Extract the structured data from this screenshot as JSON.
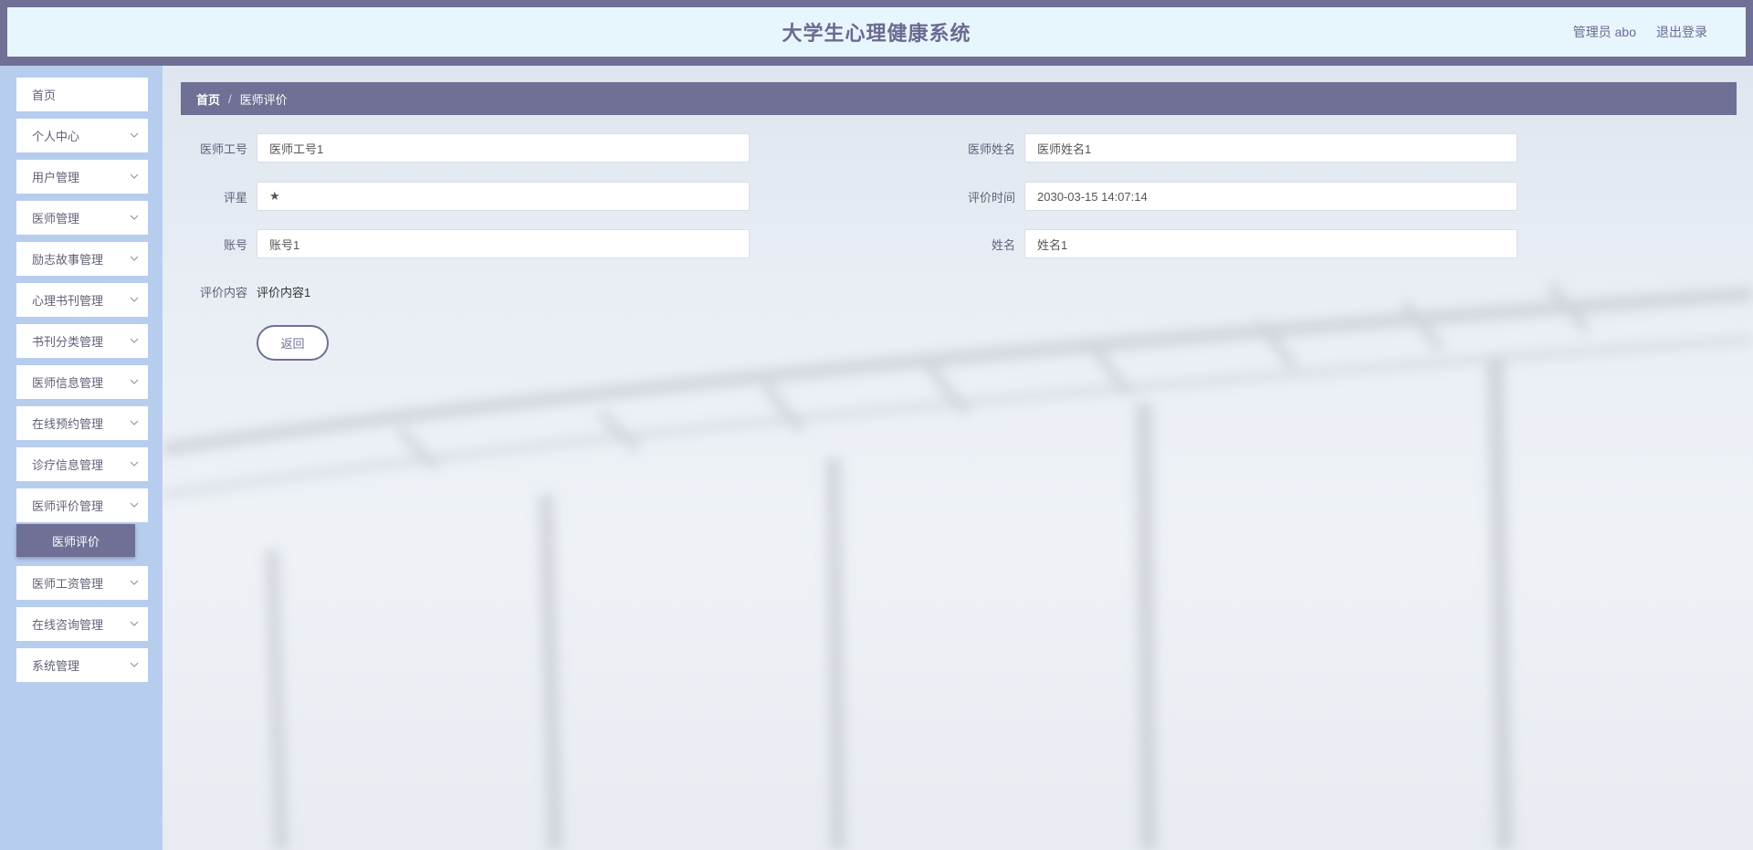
{
  "header": {
    "title": "大学生心理健康系统",
    "user_label": "管理员 abo",
    "logout_label": "退出登录"
  },
  "sidebar": {
    "items": [
      {
        "label": "首页",
        "has_chevron": false
      },
      {
        "label": "个人中心",
        "has_chevron": true
      },
      {
        "label": "用户管理",
        "has_chevron": true
      },
      {
        "label": "医师管理",
        "has_chevron": true
      },
      {
        "label": "励志故事管理",
        "has_chevron": true
      },
      {
        "label": "心理书刊管理",
        "has_chevron": true
      },
      {
        "label": "书刊分类管理",
        "has_chevron": true
      },
      {
        "label": "医师信息管理",
        "has_chevron": true
      },
      {
        "label": "在线预约管理",
        "has_chevron": true
      },
      {
        "label": "诊疗信息管理",
        "has_chevron": true
      },
      {
        "label": "医师评价管理",
        "has_chevron": true,
        "expanded": true
      },
      {
        "label": "医师工资管理",
        "has_chevron": true
      },
      {
        "label": "在线咨询管理",
        "has_chevron": true
      },
      {
        "label": "系统管理",
        "has_chevron": true
      }
    ],
    "active_sub_item": "医师评价"
  },
  "breadcrumb": {
    "home": "首页",
    "separator": "/",
    "current": "医师评价"
  },
  "form": {
    "doctor_id_label": "医师工号",
    "doctor_id_value": "医师工号1",
    "doctor_name_label": "医师姓名",
    "doctor_name_value": "医师姓名1",
    "rating_label": "评星",
    "rating_value": "★",
    "review_time_label": "评价时间",
    "review_time_value": "2030-03-15 14:07:14",
    "account_label": "账号",
    "account_value": "账号1",
    "name_label": "姓名",
    "name_value": "姓名1",
    "content_label": "评价内容",
    "content_value": "评价内容1",
    "back_label": "返回"
  },
  "colors": {
    "accent": "#706f96",
    "header_bg": "#e7f5fd",
    "sidebar_bg": "#b6cdee"
  }
}
